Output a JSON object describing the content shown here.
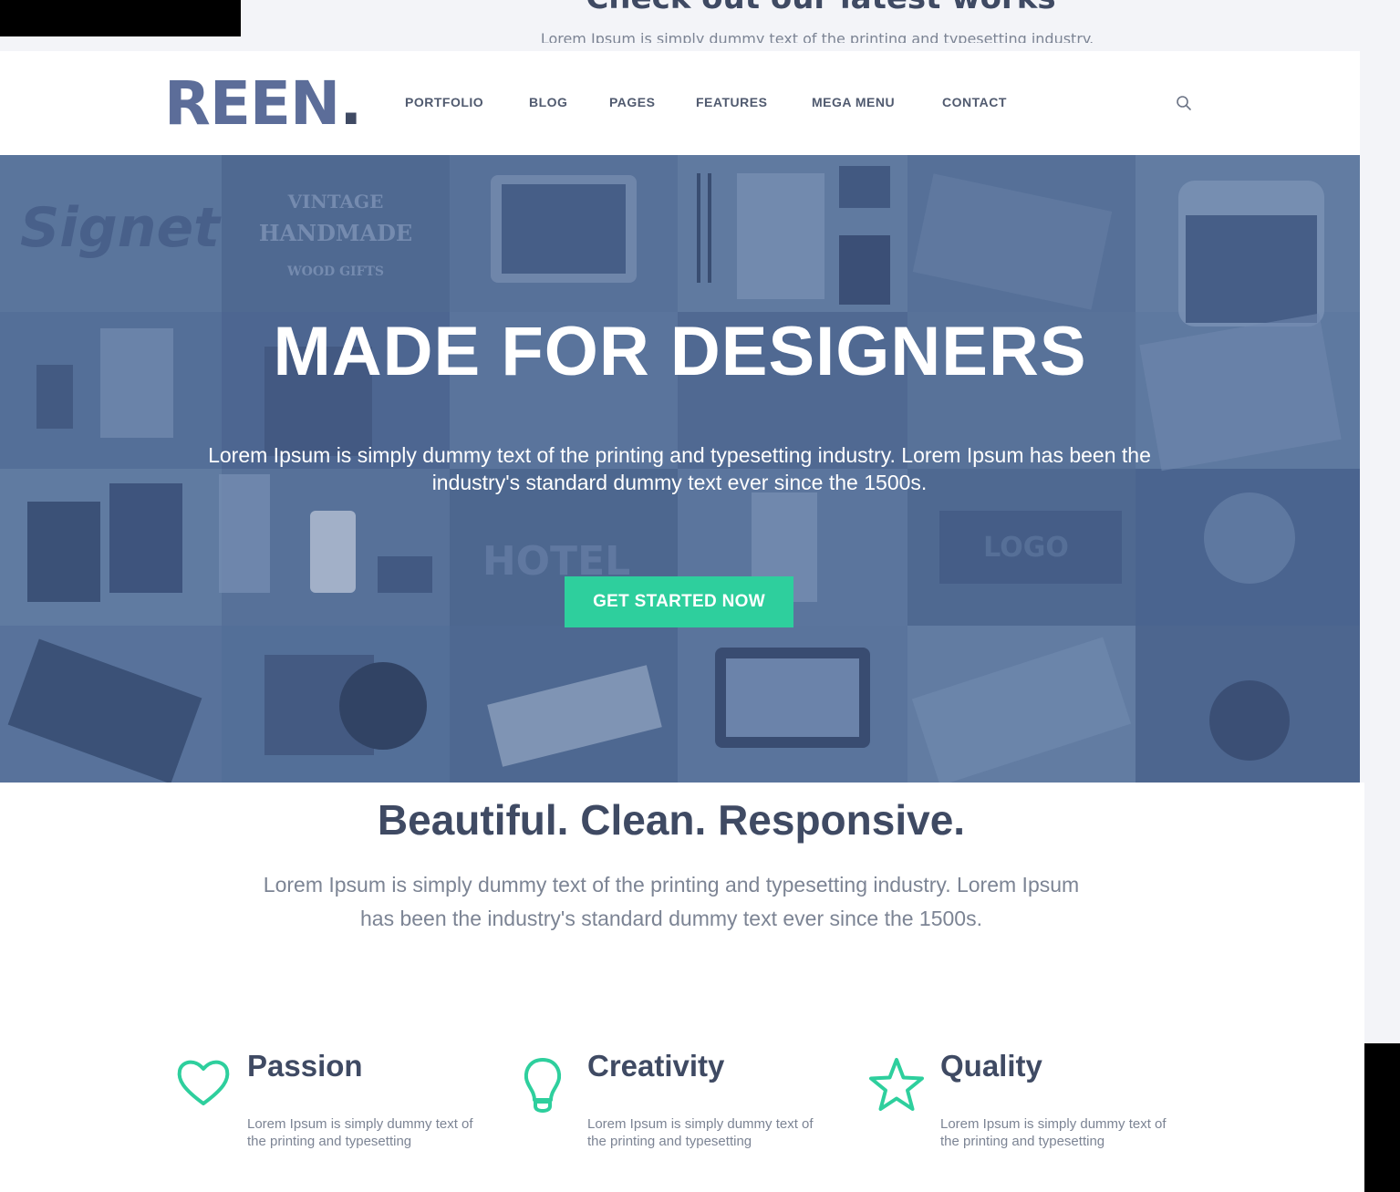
{
  "behind": {
    "heading": "Check out our latest works",
    "subtext": "Lorem Ipsum is simply dummy text of the printing and typesetting industry."
  },
  "header": {
    "logo": "REEN",
    "logo_dot": ".",
    "nav": [
      "PORTFOLIO",
      "BLOG",
      "PAGES",
      "FEATURES",
      "MEGA MENU",
      "CONTACT"
    ],
    "search_icon": "search-icon"
  },
  "hero": {
    "title": "MADE FOR DESIGNERS",
    "text": "Lorem Ipsum is simply dummy text of the printing and typesetting industry. Lorem Ipsum has been the industry's standard dummy text ever since the 1500s.",
    "button": "GET STARTED NOW",
    "image_text": {
      "signet": "Signet",
      "vintage": "VINTAGE",
      "handmade": "HANDMADE",
      "wood_gifts": "WOOD GIFTS",
      "logo": "LOGO",
      "hotel": "HOTEL"
    }
  },
  "section": {
    "title": "Beautiful. Clean. Responsive.",
    "text": "Lorem Ipsum is simply dummy text of the printing and typesetting industry. Lorem Ipsum has been the industry's standard dummy text ever since the 1500s."
  },
  "features": [
    {
      "icon": "heart-icon",
      "title": "Passion",
      "text": "Lorem Ipsum is simply dummy text of the printing and typesetting"
    },
    {
      "icon": "lightbulb-icon",
      "title": "Creativity",
      "text": "Lorem Ipsum is simply dummy text of the printing and typesetting"
    },
    {
      "icon": "star-icon",
      "title": "Quality",
      "text": "Lorem Ipsum is simply dummy text of the printing and typesetting"
    }
  ],
  "colors": {
    "accent": "#2ecf9d",
    "heading": "#3f4a63",
    "logo": "#5c6d99",
    "hero_tint": "#516a8f"
  }
}
